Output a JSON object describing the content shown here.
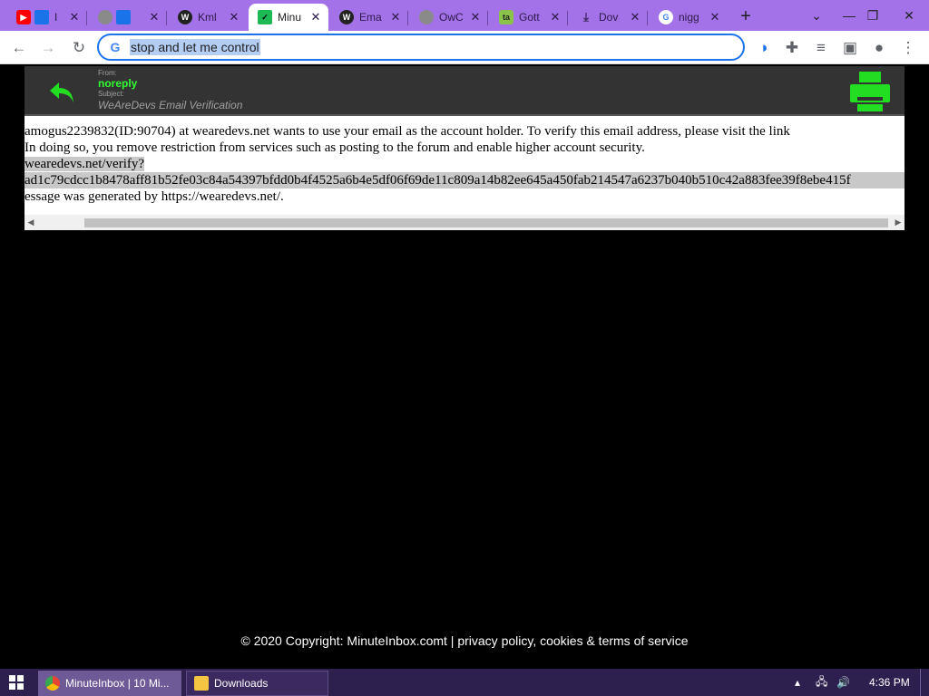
{
  "tabs": [
    {
      "title": "I",
      "favicon": "youtube-icon",
      "color": "#ff0000"
    },
    {
      "title": "",
      "favicon": "globe-icon",
      "color": "#8a8a8a"
    },
    {
      "title": "Kml",
      "favicon": "wrd-icon",
      "color": "#222222"
    },
    {
      "title": "Minu",
      "favicon": "minuteinbox-icon",
      "color": "#1db954"
    },
    {
      "title": "Ema",
      "favicon": "wrd-icon",
      "color": "#222222"
    },
    {
      "title": "OwC",
      "favicon": "globe-icon",
      "color": "#8a8a8a"
    },
    {
      "title": "Gott",
      "favicon": "ta-icon",
      "color": "#8bc34a"
    },
    {
      "title": "Dov",
      "favicon": "download-icon",
      "color": "#5f6368"
    },
    {
      "title": "nigg",
      "favicon": "google-icon",
      "color": "#4285f4"
    }
  ],
  "omnibox": {
    "text": "stop and let me control"
  },
  "mail": {
    "from_label": "From:",
    "from": "noreply",
    "subject_label": "Subject:",
    "subject": "WeAreDevs Email Verification",
    "body_lines": [
      "amogus2239832(ID:90704) at wearedevs.net wants to use your email as the account holder. To verify this email address, please visit the link",
      "In doing so, you remove restriction from services such as posting to the forum and enable higher account security.",
      "wearedevs.net/verify?",
      "ad1c79cdcc1b8478aff81b52fe03c84a54397bfdd0b4f4525a6b4e5df06f69de11c809a14b82ee645a450fab214547a6237b040b510c42a883fee39f8ebe415f",
      "essage was generated by https://wearedevs.net/."
    ]
  },
  "footer": {
    "text": "© 2020 Copyright: MinuteInbox.comt | privacy policy, cookies & terms of service"
  },
  "taskbar": {
    "items": [
      {
        "label": "MinuteInbox | 10 Mi..."
      },
      {
        "label": "Downloads"
      }
    ],
    "clock": "4:36 PM"
  },
  "colors": {
    "tabstrip": "#a472e8",
    "accent_green": "#33ff33",
    "taskbar": "#2d1f4e"
  }
}
